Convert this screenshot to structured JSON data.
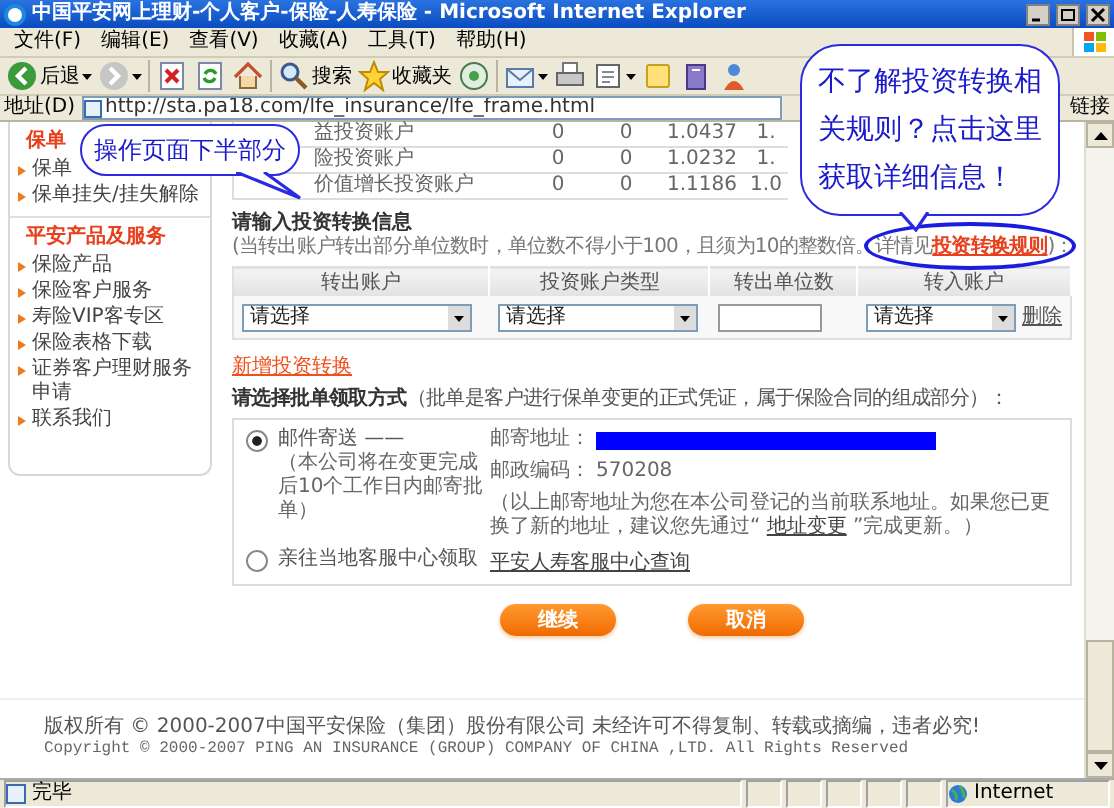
{
  "window": {
    "title": "中国平安网上理财-个人客户-保险-人寿保险 - Microsoft Internet Explorer"
  },
  "menu": [
    "文件(F)",
    "编辑(E)",
    "查看(V)",
    "收藏(A)",
    "工具(T)",
    "帮助(H)"
  ],
  "toolbar": [
    {
      "kind": "back",
      "label": "后退",
      "dropdown": true
    },
    {
      "kind": "forward",
      "dropdown": true
    },
    {
      "kind": "stop",
      "dropdown": false
    },
    {
      "kind": "refresh",
      "dropdown": false
    },
    {
      "kind": "home",
      "dropdown": false
    },
    {
      "kind": "search",
      "label": "搜索",
      "dropdown": false
    },
    {
      "kind": "favorites",
      "label": "收藏夹",
      "dropdown": false
    },
    {
      "kind": "media",
      "dropdown": false
    },
    {
      "kind": "mail",
      "dropdown": true
    },
    {
      "kind": "print",
      "dropdown": false
    },
    {
      "kind": "edit",
      "dropdown": true
    },
    {
      "kind": "note",
      "dropdown": false
    },
    {
      "kind": "research",
      "dropdown": false
    },
    {
      "kind": "messenger",
      "dropdown": false
    }
  ],
  "address_bar": {
    "label": "地址(D)",
    "value": "http://sta.pa18.com/lfe_insurance/lfe_frame.html",
    "links": "链接"
  },
  "sidebar": {
    "sections": [
      {
        "title": "保单",
        "items": [
          "保单",
          "保单挂失/挂失解除"
        ]
      },
      {
        "title": "平安产品及服务",
        "items": [
          "保险产品",
          "保险客户服务",
          "寿险VIP客专区",
          "保险表格下载",
          "证券客户理财服务申请",
          "联系我们"
        ]
      }
    ]
  },
  "accounts": {
    "rows": [
      {
        "cells": [
          "益投资账户",
          "0",
          "0",
          "1.0437",
          "1."
        ]
      },
      {
        "cells": [
          "险投资账户",
          "0",
          "0",
          "1.0232",
          "1."
        ]
      },
      {
        "cells": [
          "价值增长投资账户",
          "0",
          "0",
          "1.1186",
          "1.0"
        ]
      }
    ]
  },
  "transfer": {
    "title": "请输入投资转换信息",
    "note": "(当转出账户转出部分单位数时，单位数不得小于100，且须为10的整数倍。详情见",
    "rule_link": "投资转换规则",
    "note_end": ")：",
    "columns": [
      "转出账户",
      "投资账户类型",
      "转出单位数",
      "转入账户"
    ],
    "row": {
      "from_account": "请选择",
      "account_type": "请选择",
      "to_account": "请选择",
      "delete": "删除"
    },
    "add_link": "新增投资转换"
  },
  "delivery": {
    "prompt": "**请选择批单领取方式**（批单是客户进行保单变更的正式凭证，属于保险合同的组成部分）：",
    "options": [
      {
        "label": "邮件寄送 ——",
        "note": "（本公司将在变更完成后10个工作日内邮寄批单）",
        "selected": true
      },
      {
        "label": "亲往当地客服中心领取",
        "selected": false
      }
    ],
    "mail_details": {
      "address_label": "邮寄地址：",
      "postcode_label": "邮政编码：",
      "postcode": "570208",
      "note_before": "（以上邮寄地址为您在本公司登记的当前联系地址。如果您已更换了新的地址，建议您先通过“ ",
      "change_link": "地址变更",
      "note_after": " ”完成更新。）"
    },
    "service_link": "平安人寿客服中心查询"
  },
  "buttons": [
    "继续",
    "取消"
  ],
  "footer": [
    "版权所有 © 2000-2007中国平安保险（集团）股份有限公司 未经许可不得复制、转载或摘编，违者必究!",
    "Copyright © 2000-2007 PING AN INSURANCE (GROUP) COMPANY OF CHINA ,LTD. All Rights Reserved"
  ],
  "status_bar": {
    "text": "完毕",
    "zone": "Internet"
  },
  "callouts": [
    {
      "text": "操作页面下半部分"
    },
    {
      "text": "不了解投资转换相关规则？点击这里获取详细信息！"
    }
  ]
}
